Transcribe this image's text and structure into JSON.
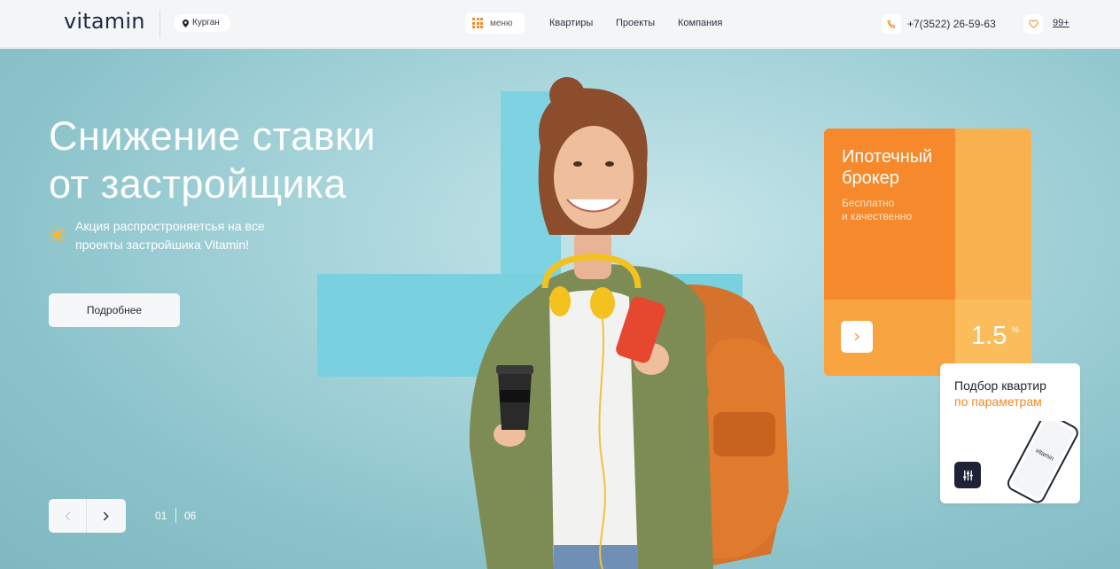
{
  "header": {
    "logo": "vitamin",
    "city": "Курган",
    "menu_label": "меню",
    "nav": [
      "Квартиры",
      "Проекты",
      "Компания"
    ],
    "phone": "+7(3522) 26-59-63",
    "favorites_count": "99+"
  },
  "hero": {
    "title_line1": "Снижение ставки",
    "title_line2": "от застройщика",
    "promo_text": "Акция распростроняетсья на все проекты застройшика Vitamin!",
    "more_button": "Подробнее",
    "slide_current": "01",
    "slide_total": "06"
  },
  "broker_card": {
    "title": "Ипотечный брокер",
    "subtitle_line1": "Бесплатно",
    "subtitle_line2": "и качественно",
    "rate": "1.5",
    "rate_unit": "%"
  },
  "params_card": {
    "line1": "Подбор квартир",
    "line2": "по параметрам",
    "phone_logo": "vitamin"
  },
  "colors": {
    "accent_orange": "#f5892c",
    "cross_cyan": "#7dd3e2",
    "hero_bg": "#a8d5db",
    "dark_icon_bg": "#1f2236"
  }
}
